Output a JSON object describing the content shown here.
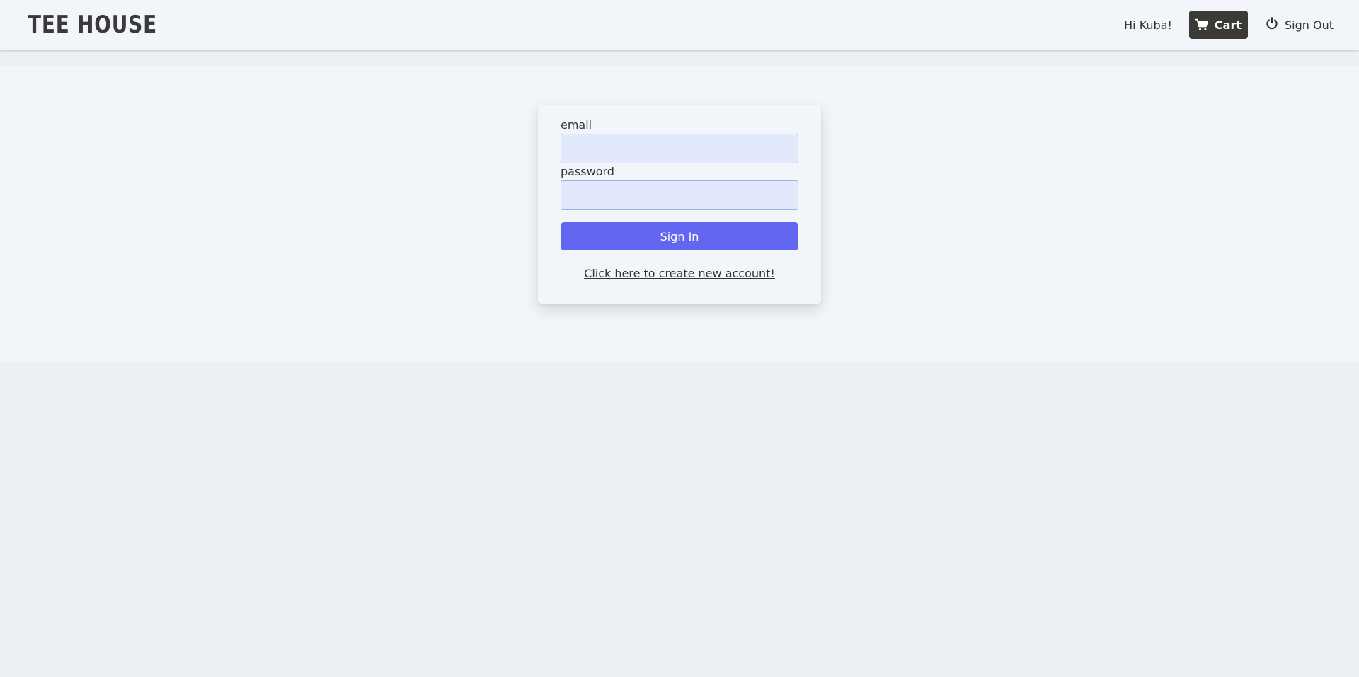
{
  "header": {
    "logo": "TEE HOUSE",
    "greeting": "Hi Kuba!",
    "cart_label": "Cart",
    "signout_label": "Sign Out",
    "cart_icon": "cart-icon",
    "signout_icon": "power-icon"
  },
  "login_form": {
    "email_label": "email",
    "email_value": "",
    "password_label": "password",
    "password_value": "",
    "submit_label": "Sign In",
    "create_account_link": "Click here to create new account!"
  },
  "colors": {
    "page_background": "#ecf0f3",
    "panel_background": "#f2f5f9",
    "cart_button": "#3c3a37",
    "primary_button": "#6366f1",
    "input_background": "#e3e9fd",
    "input_border": "#9fb1e8"
  }
}
